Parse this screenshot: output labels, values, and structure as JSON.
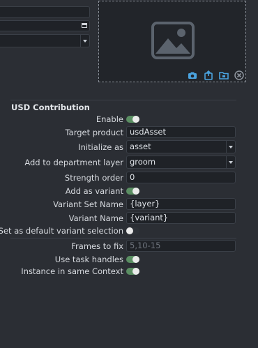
{
  "top_fields": {
    "field1_value": "",
    "field2_value": "",
    "field3_value": ""
  },
  "thumbnail": {
    "placeholder_icon": "image-placeholder-icon",
    "toolbar_icons": [
      "camera-icon",
      "paste-icon",
      "folder-icon",
      "clear-icon"
    ],
    "accent_color": "#4aa3df"
  },
  "usd": {
    "section_title": "USD Contribution",
    "enable_label": "Enable",
    "enable_on": true,
    "target_product_label": "Target product",
    "target_product_value": "usdAsset",
    "initialize_as_label": "Initialize as",
    "initialize_as_value": "asset",
    "department_layer_label": "Add to department layer",
    "department_layer_value": "groom",
    "strength_order_label": "Strength order",
    "strength_order_value": "0",
    "add_as_variant_label": "Add as variant",
    "add_as_variant_on": true,
    "variant_set_name_label": "Variant Set Name",
    "variant_set_name_value": "{layer}",
    "variant_name_label": "Variant Name",
    "variant_name_value": "{variant}",
    "default_variant_label": "Set as default variant selection",
    "default_variant_on": false
  },
  "extra": {
    "frames_to_fix_label": "Frames to fix",
    "frames_to_fix_placeholder": "5,10-15",
    "use_task_handles_label": "Use task handles",
    "use_task_handles_on": true,
    "instance_context_label": "Instance in same Context",
    "instance_context_on": true
  },
  "colors": {
    "toggle_on": "#5a8e62",
    "background": "#2b2e34"
  }
}
